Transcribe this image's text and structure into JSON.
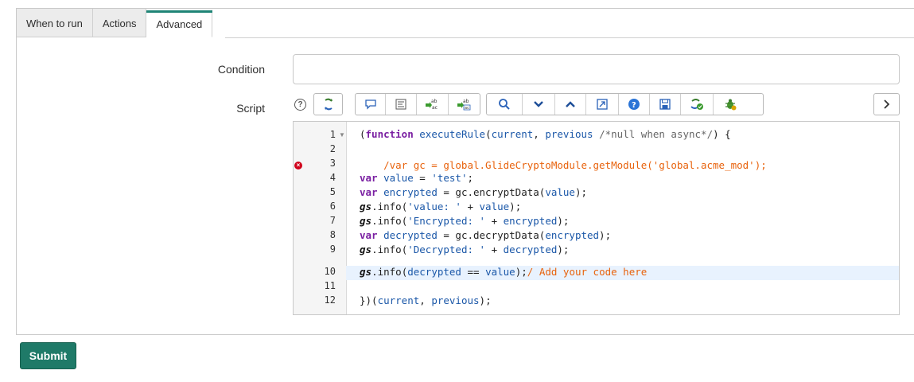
{
  "tabs": [
    {
      "label": "When to run",
      "active": false
    },
    {
      "label": "Actions",
      "active": false
    },
    {
      "label": "Advanced",
      "active": true
    }
  ],
  "form": {
    "condition_label": "Condition",
    "condition_value": "",
    "script_label": "Script"
  },
  "toolbar": {
    "icons": [
      "help-icon",
      "script-includes-icon",
      "comment-icon",
      "format-icon",
      "replace-icon",
      "replace-all-icon",
      "search-icon",
      "fold-down-icon",
      "fold-up-icon",
      "fullscreen-icon",
      "help-circle-icon",
      "save-icon",
      "syntax-check-icon",
      "debug-icon",
      "expand-right-icon"
    ]
  },
  "editor": {
    "lines": [
      {
        "n": "1",
        "text": "(function executeRule(current, previous /*null when async*/) {"
      },
      {
        "n": "2",
        "text": ""
      },
      {
        "n": "3",
        "text": "    /var gc = global.GlideCryptoModule.getModule('global.acme_mod');",
        "error": true
      },
      {
        "n": "4",
        "text": "var value = 'test';"
      },
      {
        "n": "5",
        "text": "var encrypted = gc.encryptData(value);"
      },
      {
        "n": "6",
        "text": "gs.info('value: ' + value);"
      },
      {
        "n": "7",
        "text": "gs.info('Encrypted: ' + encrypted);"
      },
      {
        "n": "8",
        "text": "var decrypted = gc.decryptData(encrypted);"
      },
      {
        "n": "9",
        "text": "gs.info('Decrypted: ' + decrypted);"
      },
      {
        "n": "10",
        "text": "gs.info(decrypted == value);/ Add your code here",
        "active": true
      },
      {
        "n": "11",
        "text": ""
      },
      {
        "n": "12",
        "text": "})(current, previous);"
      }
    ]
  },
  "actions": {
    "submit_label": "Submit"
  },
  "colors": {
    "accent": "#1f7a68",
    "error": "#d0021b",
    "keyword": "#7a1fa2",
    "string": "#1a57a8",
    "comment_orange": "#e8620c"
  }
}
